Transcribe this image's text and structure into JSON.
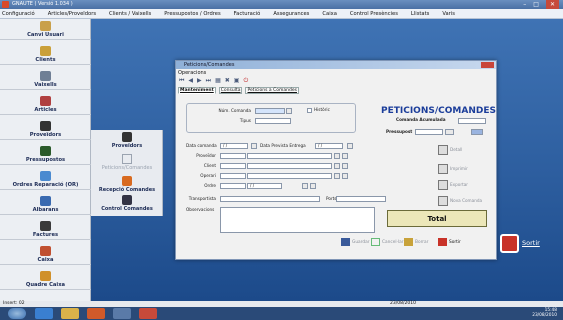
{
  "titlebar": {
    "title": "GNAUTE  ( Versió 1.034 )",
    "controls": [
      "–",
      "□",
      "✕"
    ]
  },
  "menubar": [
    "Configuració",
    "Articles/Proveïdors",
    "Clients / Vaixells",
    "Pressupostos / Ordres",
    "Facturació",
    "Assegurances",
    "Caixa",
    "Control Presències",
    "Llistats",
    "Varis"
  ],
  "sidebar": [
    {
      "label": "Canvi Usuari",
      "icon": "lock-icon",
      "color": "#c9a04a"
    },
    {
      "label": "Clients",
      "icon": "clients-icon",
      "color": "#caa03a"
    },
    {
      "label": "Vaixells",
      "icon": "ship-icon",
      "color": "#6f7f95"
    },
    {
      "label": "Articles",
      "icon": "articles-icon",
      "color": "#b04040"
    },
    {
      "label": "Proveïdors",
      "icon": "suppliers-icon",
      "color": "#333333"
    },
    {
      "label": "Pressupostos",
      "icon": "budget-icon",
      "color": "#2a5a2a"
    },
    {
      "label": "Ordres Reparació (OR)",
      "icon": "repair-order-icon",
      "color": "#4a8ad0"
    },
    {
      "label": "Albarans",
      "icon": "delivery-note-icon",
      "color": "#3a6ab0"
    },
    {
      "label": "Factures",
      "icon": "invoice-icon",
      "color": "#3a3a3a"
    },
    {
      "label": "Caixa",
      "icon": "cash-box-icon",
      "color": "#c05030"
    },
    {
      "label": "Quadre Caixa",
      "icon": "cash-summary-icon",
      "color": "#d0902a"
    }
  ],
  "subpanel": [
    {
      "label": "Proveïdors",
      "icon": "suppliers-icon",
      "dim": false
    },
    {
      "label": "Peticions/Comandes",
      "icon": "orders-icon",
      "dim": true
    },
    {
      "label": "Recepció Comandes",
      "icon": "receive-orders-icon",
      "dim": false
    },
    {
      "label": "Control Comandes",
      "icon": "control-orders-icon",
      "dim": false
    }
  ],
  "window": {
    "title": "Peticions/Comandes",
    "menu": "Operacions",
    "tabs": [
      "Manteniment",
      "Consulta",
      "Peticions a Comandes"
    ],
    "num_comanda_label": "Núm. Comanda",
    "historic_label": "Històric",
    "tipus_label": "Tipus",
    "big_title": "PETICIONS/COMANDES",
    "acumulada_label": "Comanda Acumulada",
    "pressupost_label": "Pressupost",
    "data_comanda_label": "Data comanda",
    "data_comanda_value": "/ /",
    "data_entrega_label": "Data Prevista Entrega",
    "data_entrega_value": "/ /",
    "proveidor_label": "Proveïdor",
    "client_label": "Client",
    "operari_label": "Operari",
    "ordre_label": "Ordre",
    "ordre_date": "/ /",
    "transportista_label": "Transportista",
    "ports_label": "Ports",
    "observacions_label": "Observacions",
    "side_buttons": [
      "Detall",
      "Imprimir",
      "Exportar",
      "Nova Comanda"
    ],
    "total_label": "Total",
    "bottom_buttons": [
      "Guardar",
      "Cancel·lar",
      "Borrar",
      "Sortir"
    ]
  },
  "sortir_label": "Sortir",
  "statusbar": {
    "left": "Insert: 02",
    "date": "23/08/2010"
  },
  "clock": {
    "time": "15:48",
    "date": "23/08/2010"
  },
  "colors": {
    "accent": "#1b3d9a",
    "desktop": "#2d5e9f",
    "danger": "#c83228"
  }
}
